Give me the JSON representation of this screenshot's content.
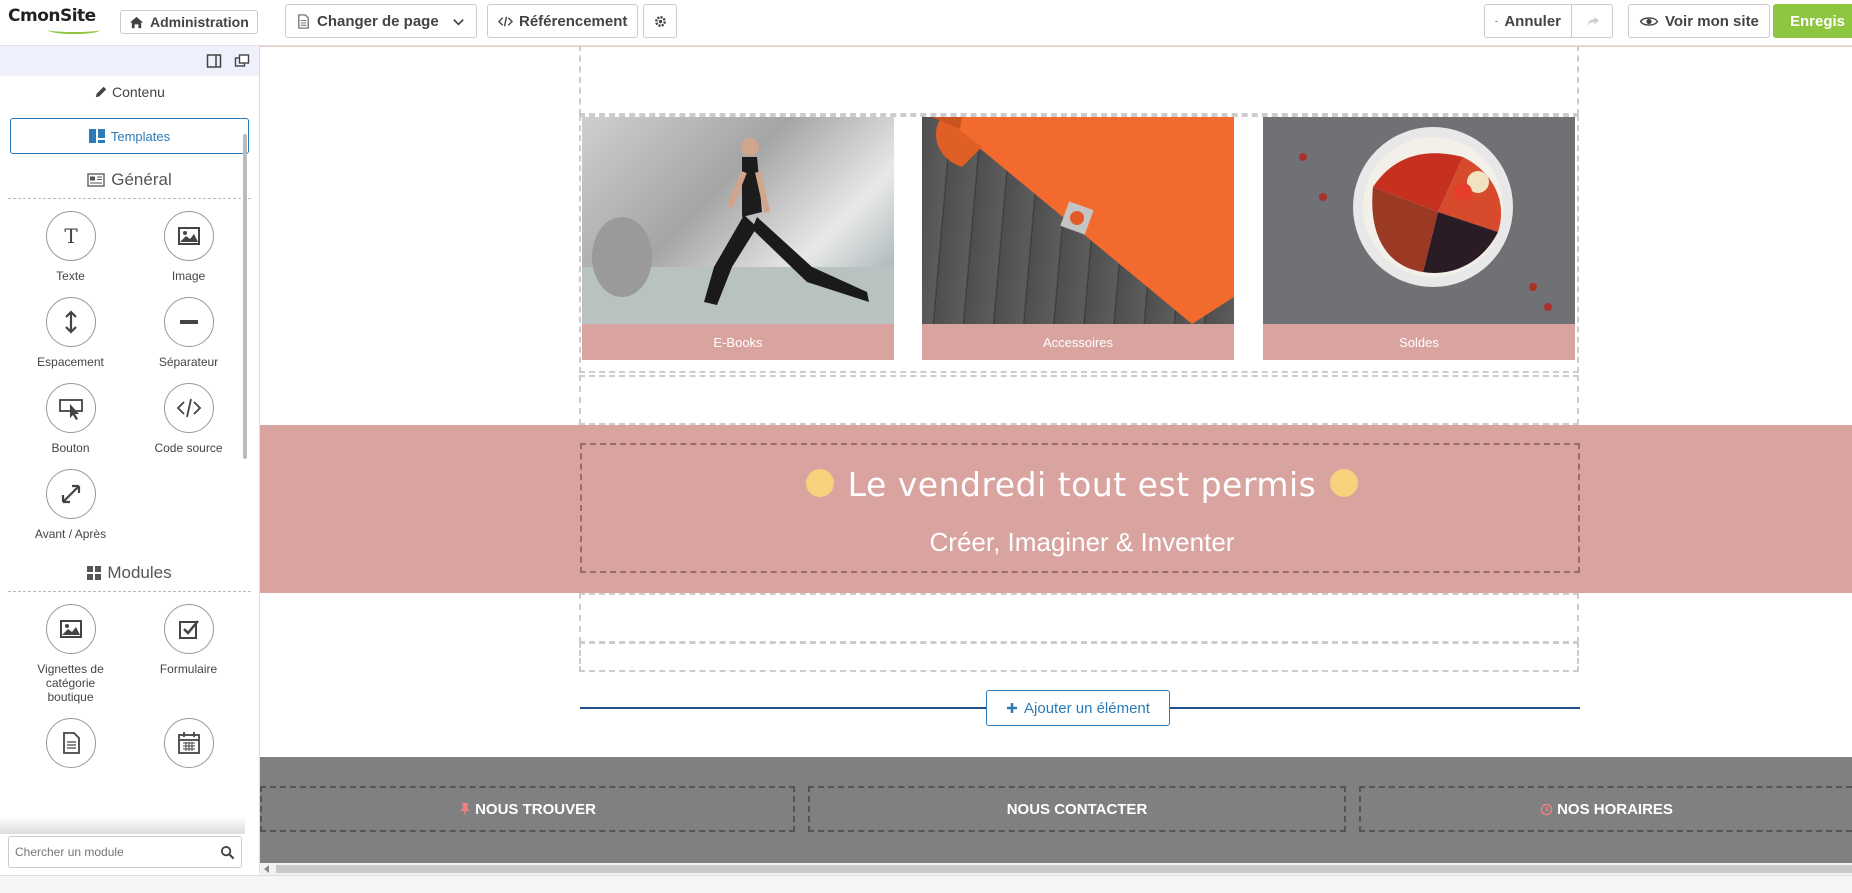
{
  "brand": {
    "logo": "CmonSite"
  },
  "toolbar": {
    "admin_label": "Administration",
    "page_label": "Changer de page",
    "seo_label": "Référencement",
    "undo_label": "Annuler",
    "view_label": "Voir mon site",
    "save_label": "Enregis"
  },
  "sidebar": {
    "content_label": "Contenu",
    "templates_label": "Templates",
    "general_title": "Général",
    "general_items": [
      "Texte",
      "Image",
      "Espacement",
      "Séparateur",
      "Bouton",
      "Code source",
      "Avant / Après"
    ],
    "modules_title": "Modules",
    "module_items": [
      "Vignettes de catégorie boutique",
      "Formulaire"
    ],
    "search_placeholder": "Chercher un module"
  },
  "canvas": {
    "cards": [
      "E-Books",
      "Accessoires",
      "Soldes"
    ],
    "banner_title": "Le vendredi tout est permis",
    "banner_subtitle": "Créer, Imaginer & Inventer",
    "add_element_label": "Ajouter un élément",
    "footer": [
      "NOUS TROUVER",
      "NOUS CONTACTER",
      "NOS HORAIRES"
    ]
  },
  "colors": {
    "accent": "#2b7bb9",
    "save": "#8dc63f",
    "rose": "#d9a3a0",
    "footer": "#808080",
    "dot": "#f6d27c"
  }
}
